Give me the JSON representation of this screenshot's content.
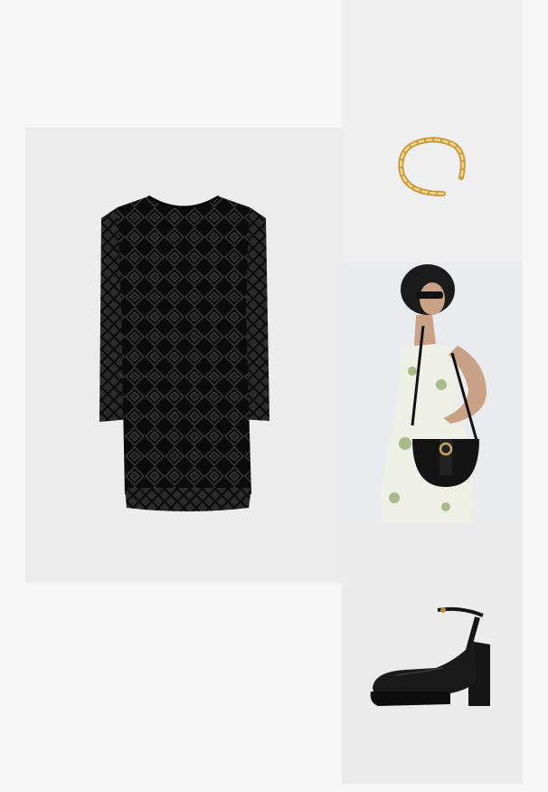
{
  "page": {
    "background": "#f6f6f6"
  },
  "outfit": {
    "items": [
      {
        "id": "dress",
        "kind": "lace long-sleeve mini dress",
        "icon": "dress-image",
        "tile_color": "#ececec",
        "item_color": "#0c0c0c"
      },
      {
        "id": "bracelet",
        "kind": "twisted cuff bracelet",
        "icon": "bracelet-image",
        "tile_color": "#efefef",
        "item_color": "#d8b25a"
      },
      {
        "id": "bag",
        "kind": "half-moon crossbody bag",
        "icon": "bag-image",
        "tile_color": "#e9ebee",
        "item_color": "#141414"
      },
      {
        "id": "shoe",
        "kind": "platform ankle-strap pump",
        "icon": "shoe-image",
        "tile_color": "#ebebeb",
        "item_color": "#151515"
      }
    ]
  }
}
